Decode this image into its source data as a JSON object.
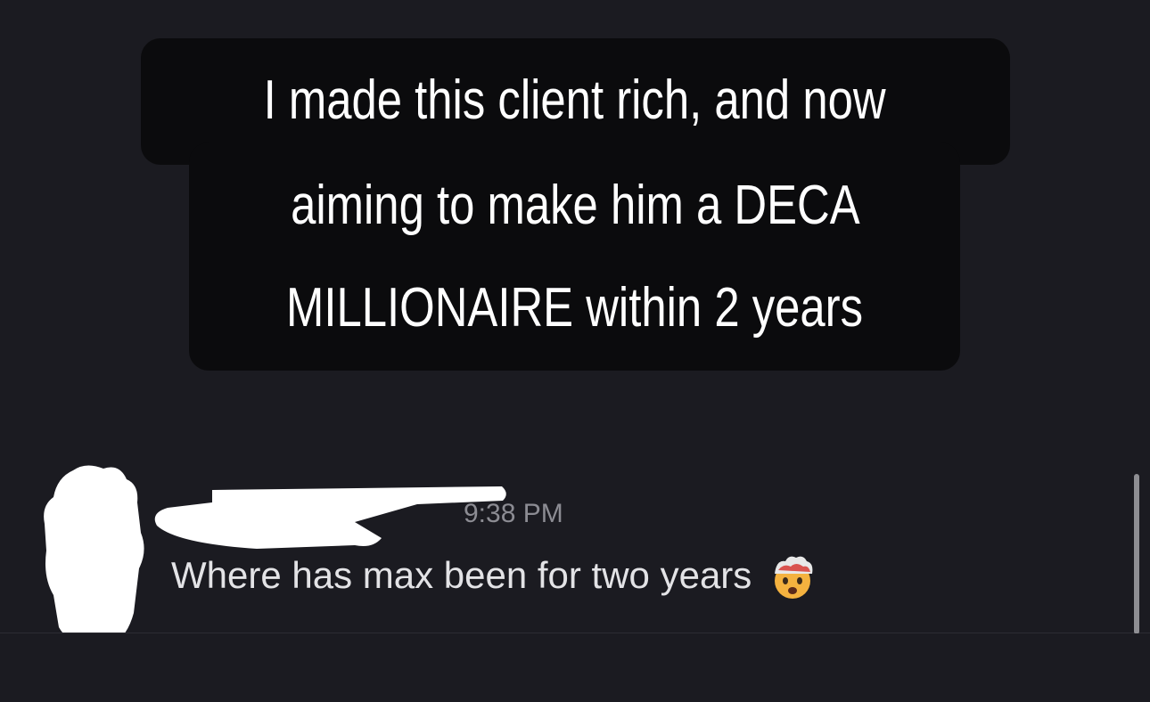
{
  "caption": {
    "lines": [
      "I made this client rich, and now",
      "aiming to make him a DECA",
      "MILLIONAIRE within 2 years"
    ]
  },
  "message": {
    "timestamp": "9:38 PM",
    "text": "Where has max been for two years",
    "emoji_icon": "exploding-head-emoji"
  },
  "colors": {
    "background": "#1b1b21",
    "caption_background": "#0b0b0d",
    "caption_text": "#ffffff",
    "message_text": "#e3e3e6",
    "timestamp_text": "#8c8c93",
    "redaction": "#ffffff"
  }
}
